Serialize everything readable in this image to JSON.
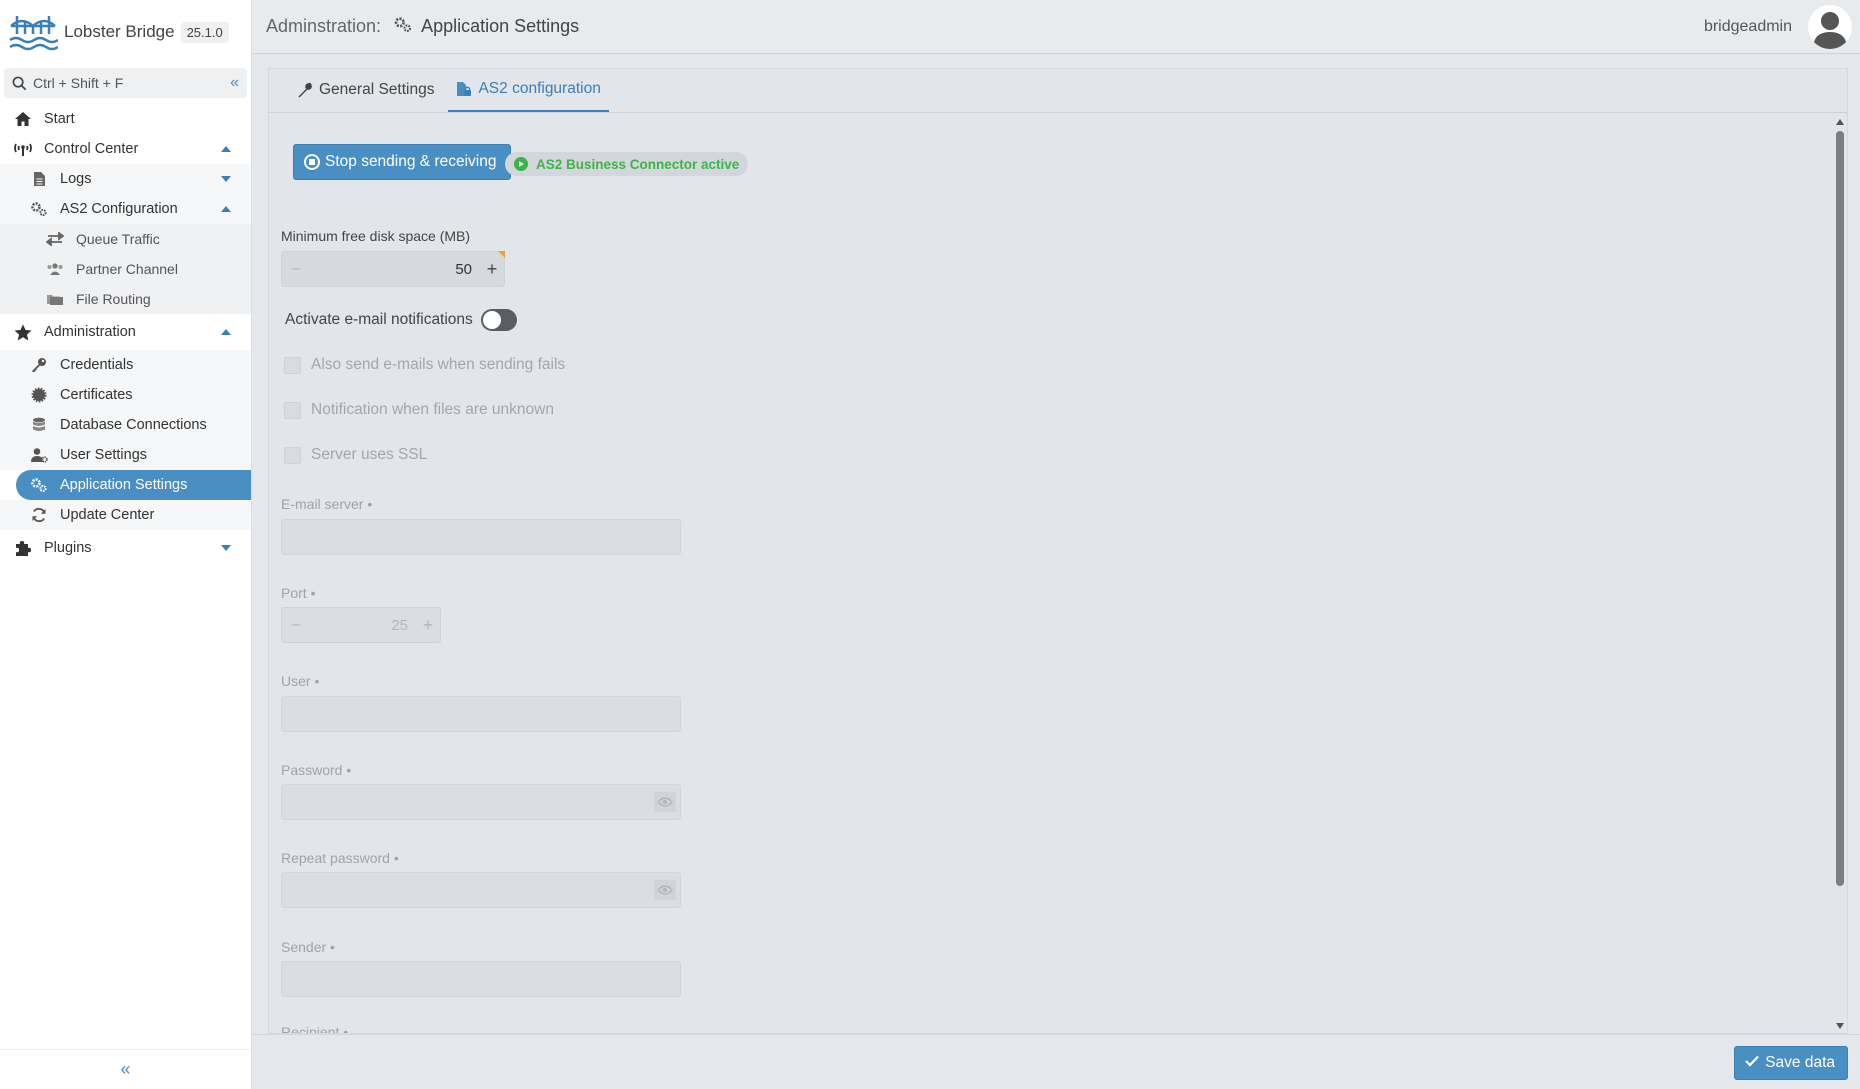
{
  "brand": {
    "name": "Lobster Bridge",
    "version": "25.1.0"
  },
  "search": {
    "placeholder": "Ctrl + Shift + F"
  },
  "sidebar": {
    "items": [
      {
        "label": "Start"
      },
      {
        "label": "Control Center"
      },
      {
        "label": "Logs"
      },
      {
        "label": "AS2 Configuration"
      },
      {
        "label": "Queue Traffic"
      },
      {
        "label": "Partner Channel"
      },
      {
        "label": "File Routing"
      },
      {
        "label": "Administration"
      },
      {
        "label": "Credentials"
      },
      {
        "label": "Certificates"
      },
      {
        "label": "Database Connections"
      },
      {
        "label": "User Settings"
      },
      {
        "label": "Application Settings"
      },
      {
        "label": "Update Center"
      },
      {
        "label": "Plugins"
      }
    ]
  },
  "header": {
    "crumb": "Adminstration:",
    "title": "Application Settings",
    "user": "bridgeadmin"
  },
  "tabs": [
    {
      "label": "General Settings"
    },
    {
      "label": "AS2 configuration"
    }
  ],
  "form": {
    "stop_button": "Stop sending & receiving",
    "status_badge": "AS2 Business Connector active",
    "min_disk_label": "Minimum free disk space (MB)",
    "min_disk_value": "50",
    "email_toggle_label": "Activate e-mail notifications",
    "chk_send_fails": "Also send e-mails when sending fails",
    "chk_unknown_files": "Notification when files are unknown",
    "chk_ssl": "Server uses SSL",
    "email_server_label": "E-mail server •",
    "port_label": "Port •",
    "port_value": "25",
    "user_label": "User •",
    "password_label": "Password •",
    "repeat_password_label": "Repeat password •",
    "sender_label": "Sender •",
    "recipient_label": "Recipient •"
  },
  "footer": {
    "save_label": "Save data"
  },
  "colors": {
    "accent": "#4a8fc4",
    "success": "#3db34a",
    "warning_flag": "#f0a030"
  }
}
